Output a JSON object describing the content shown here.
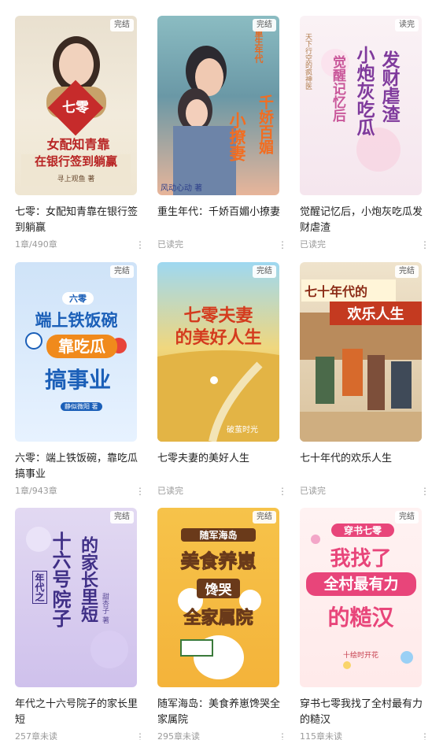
{
  "books": [
    {
      "badge": "完结",
      "title": "七零：女配知青靠在银行签到躺赢",
      "meta": "1章/490章",
      "cover": {
        "line1": "七零",
        "line2": "女配知青靠",
        "line3": "在银行签到躺赢",
        "author": "寻上观鱼 著"
      }
    },
    {
      "badge": "完结",
      "title": "重生年代：千娇百媚小撩妻",
      "meta": "已读完",
      "cover": {
        "line1": "重生年代",
        "line2": "千娇百媚",
        "line3": "小撩妻",
        "author": "风动心动 著"
      }
    },
    {
      "badge": "读完",
      "title": "觉醒记忆后，小炮灰吃瓜发财虐渣",
      "meta": "已读完",
      "cover": {
        "line1": "觉醒记忆后",
        "line2": "小炮灰吃瓜",
        "line3": "发财虐渣",
        "author": "天下行空的疯神医"
      }
    },
    {
      "badge": "完结",
      "title": "六零：端上铁饭碗，靠吃瓜搞事业",
      "meta": "1章/943章",
      "cover": {
        "line1": "六零",
        "line2": "端上铁饭碗",
        "line3": "靠吃瓜",
        "line4": "搞事业",
        "author": "静似微阳 著"
      }
    },
    {
      "badge": "完结",
      "title": "七零夫妻的美好人生",
      "meta": "已读完",
      "cover": {
        "line1": "七零夫妻",
        "line2": "的美好人生",
        "author": "破茧时光"
      }
    },
    {
      "badge": "完结",
      "title": "七十年代的欢乐人生",
      "meta": "已读完",
      "cover": {
        "line1": "七十年代的",
        "line2": "欢乐人生"
      }
    },
    {
      "badge": "完结",
      "title": "年代之十六号院子的家长里短",
      "meta": "257章未读",
      "cover": {
        "line1": "年代之",
        "line2": "十六号",
        "line3": "院子",
        "line4": "的家长里短",
        "author": "甜杏子 著"
      }
    },
    {
      "badge": "完结",
      "title": "随军海岛：美食养崽馋哭全家属院",
      "meta": "295章未读",
      "cover": {
        "line1": "随军海岛",
        "line2": "美食养崽",
        "line3": "馋哭",
        "line4": "全家属院"
      }
    },
    {
      "badge": "完结",
      "title": "穿书七零我找了全村最有力的糙汉",
      "meta": "115章未读",
      "cover": {
        "line1": "穿书七零",
        "line2": "我找了",
        "line3": "全村最有力",
        "line4": "的糙汉",
        "author": "十绘时开花"
      }
    }
  ],
  "more_icon": "more-vertical-icon",
  "more_glyph": "⋮"
}
